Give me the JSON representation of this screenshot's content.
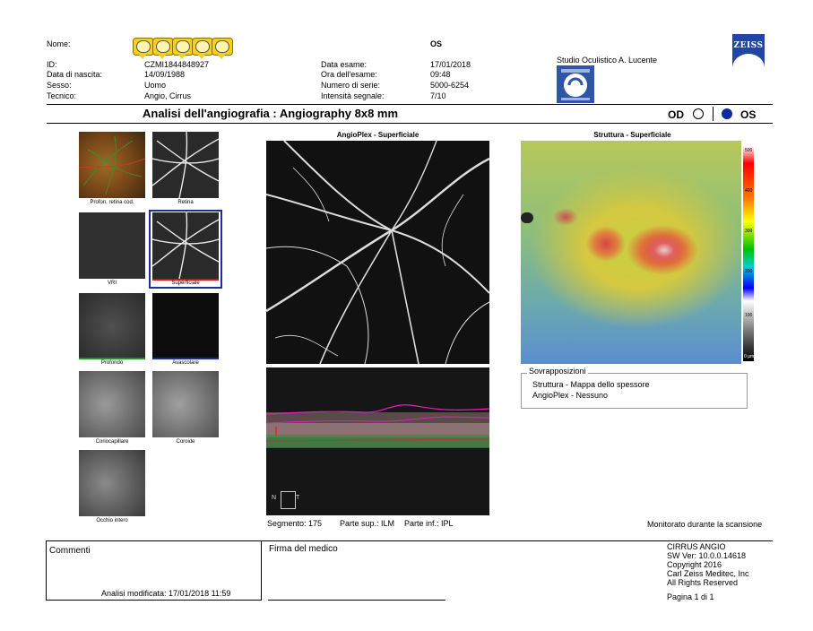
{
  "header": {
    "labels": {
      "name": "Nome:",
      "id": "ID:",
      "dob": "Data di nascita:",
      "sex": "Sesso:",
      "tech": "Tecnico:"
    },
    "values": {
      "id": "CZMI1844848927",
      "dob": "14/09/1988",
      "sex": "Uomo",
      "tech": "Angio, Cirrus"
    },
    "exam_labels": {
      "date": "Data esame:",
      "time": "Ora dell'esame:",
      "serial": "Numero di serie:",
      "signal": "Intensità segnale:"
    },
    "eye": "OS",
    "exam_values": {
      "date": "17/01/2018",
      "time": "09:48",
      "serial": "5000-6254",
      "signal": "7/10"
    },
    "studio": "Studio Oculistico A. Lucente",
    "brand": "ZEISS"
  },
  "title": {
    "text": "Analisi dell'angiografia : Angiography 8x8 mm",
    "od": "OD",
    "os": "OS"
  },
  "thumbnails": {
    "labels": [
      "Profon. retina cod.",
      "Retina",
      "VRI",
      "Superficiale",
      "Profondo",
      "Avascolare",
      "Coriocapillare",
      "Coroide",
      "Occhio intero"
    ]
  },
  "center": {
    "title": "AngioPlex - Superficiale",
    "orient_n": "N",
    "orient_t": "T"
  },
  "right": {
    "title": "Struttura - Superficiale",
    "colorbar_ticks": [
      "500",
      "400",
      "300",
      "200",
      "100",
      "0 µm"
    ],
    "overlays_title": "Sovrapposizioni",
    "overlays": [
      "Struttura - Mappa dello spessore",
      "AngioPlex - Nessuno"
    ]
  },
  "segment": {
    "text": "Segmento: 175",
    "upper": "Parte sup.: ILM",
    "lower": "Parte inf.: IPL",
    "monitor": "Monitorato durante la scansione"
  },
  "footer": {
    "comments": "Commenti",
    "modified": "Analisi modificata: 17/01/2018 11:59",
    "signature": "Firma del medico",
    "sw": [
      "CIRRUS ANGIO",
      "SW Ver: 10.0.0.14618",
      "Copyright 2016",
      "Carl Zeiss Meditec, Inc",
      "All Rights Reserved"
    ],
    "page": "Pagina 1 di 1"
  }
}
